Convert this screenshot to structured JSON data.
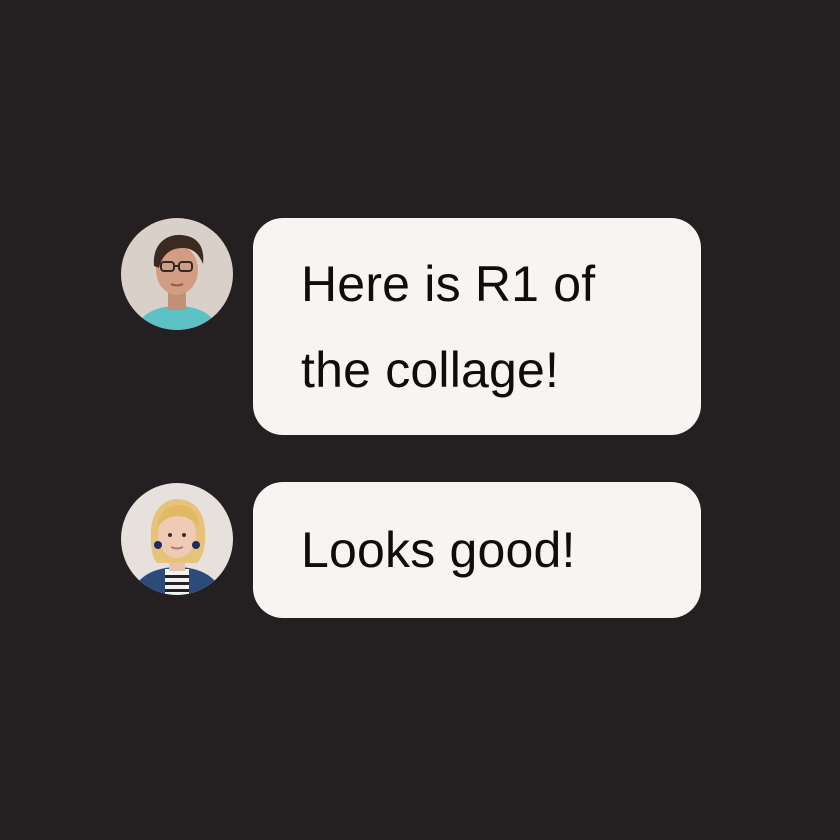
{
  "theme": {
    "background": "#242021",
    "bubble_color": "#f6f5f1",
    "text_color": "#0e0c0c"
  },
  "messages": [
    {
      "avatar": "man-with-glasses-avatar",
      "text": "Here is R1 of the collage!"
    },
    {
      "avatar": "woman-with-blonde-hair-avatar",
      "text": "Looks good!"
    }
  ]
}
